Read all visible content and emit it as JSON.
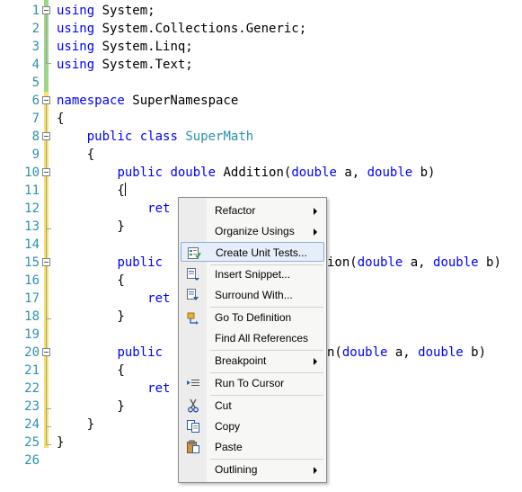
{
  "editor": {
    "line_numbers": [
      "1",
      "2",
      "3",
      "4",
      "5",
      "6",
      "7",
      "8",
      "9",
      "10",
      "11",
      "12",
      "13",
      "14",
      "15",
      "16",
      "17",
      "18",
      "19",
      "20",
      "21",
      "22",
      "23",
      "24",
      "25",
      "26"
    ],
    "code": {
      "l1_kw": "using",
      "l1_rest": " System;",
      "l2_kw": "using",
      "l2_rest": " System.Collections.Generic;",
      "l3_kw": "using",
      "l3_rest": " System.Linq;",
      "l4_kw": "using",
      "l4_rest": " System.Text;",
      "l6_kw": "namespace",
      "l6_rest": " SuperNamespace",
      "l7": "{",
      "l8_indent": "    ",
      "l8_kw1": "public",
      "l8_sp": " ",
      "l8_kw2": "class",
      "l8_sp2": " ",
      "l8_type": "SuperMath",
      "l9": "    {",
      "l10_indent": "        ",
      "l10_kw1": "public",
      "l10_sp": " ",
      "l10_kw2": "double",
      "l10_name": " Addition(",
      "l10_kw3": "double",
      "l10_a": " a, ",
      "l10_kw4": "double",
      "l10_b": " b)",
      "l11": "        {",
      "l12_indent": "            ",
      "l12_kw": "ret",
      "l13": "        }",
      "l15_indent": "        ",
      "l15_kw1": "public",
      "l15_name": "ion(",
      "l15_kw3": "double",
      "l15_a": " a, ",
      "l15_kw4": "double",
      "l15_b": " b)",
      "l16": "        {",
      "l17_indent": "            ",
      "l17_kw": "ret",
      "l18": "        }",
      "l20_indent": "        ",
      "l20_kw1": "public",
      "l20_name": "n(",
      "l20_kw3": "double",
      "l20_a": " a, ",
      "l20_kw4": "double",
      "l20_b": " b)",
      "l21": "        {",
      "l22_indent": "            ",
      "l22_kw": "ret",
      "l23": "        }",
      "l24": "    }",
      "l25": "}"
    },
    "colors": {
      "keyword": "#0000ff",
      "type": "#2b91af",
      "line_number": "#2b91af"
    }
  },
  "context_menu": {
    "items": [
      {
        "label": "Refactor",
        "submenu": true,
        "icon": "none"
      },
      {
        "label": "Organize Usings",
        "submenu": true,
        "icon": "none"
      },
      {
        "label": "Create Unit Tests...",
        "submenu": false,
        "icon": "unit-test-icon"
      },
      {
        "label": "Insert Snippet...",
        "submenu": false,
        "icon": "insert-snippet-icon"
      },
      {
        "label": "Surround With...",
        "submenu": false,
        "icon": "surround-with-icon"
      },
      {
        "label": "Go To Definition",
        "submenu": false,
        "icon": "go-to-definition-icon"
      },
      {
        "label": "Find All References",
        "submenu": false,
        "icon": "none"
      },
      {
        "label": "Breakpoint",
        "submenu": true,
        "icon": "none"
      },
      {
        "label": "Run To Cursor",
        "submenu": false,
        "icon": "run-to-cursor-icon"
      },
      {
        "label": "Cut",
        "submenu": false,
        "icon": "scissors-icon"
      },
      {
        "label": "Copy",
        "submenu": false,
        "icon": "copy-icon"
      },
      {
        "label": "Paste",
        "submenu": false,
        "icon": "paste-icon"
      },
      {
        "label": "Outlining",
        "submenu": true,
        "icon": "none"
      }
    ],
    "highlighted": "Create Unit Tests..."
  }
}
